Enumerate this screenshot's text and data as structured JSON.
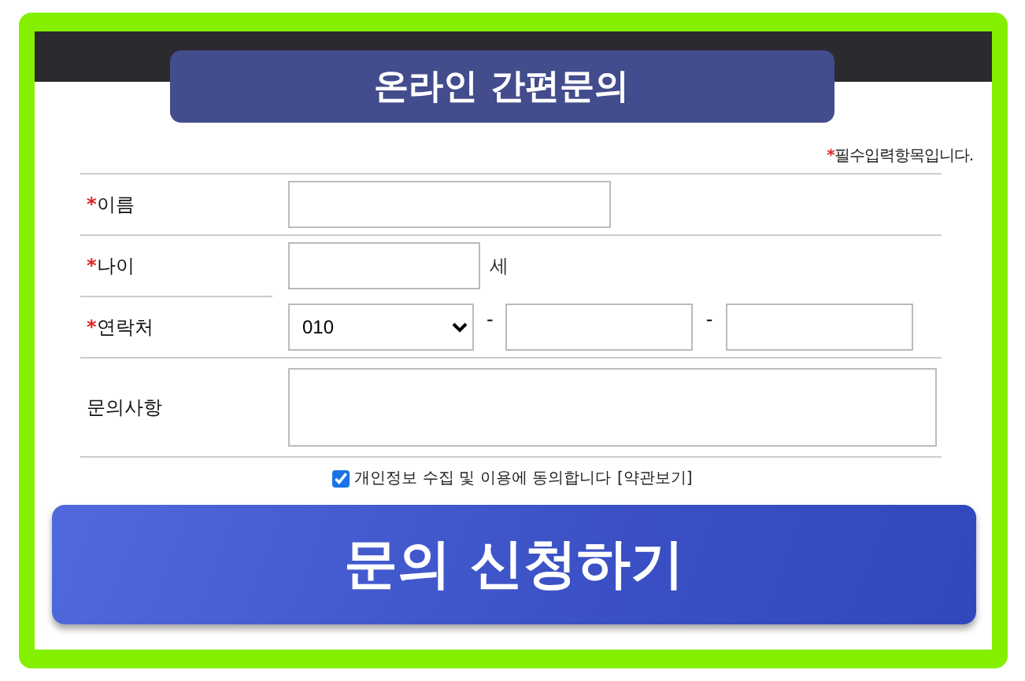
{
  "title": "온라인 간편문의",
  "required_note": {
    "mark": "*",
    "text": "필수입력항목입니다."
  },
  "rows": [
    {
      "kind": "text",
      "mark": "*",
      "label": "이름"
    },
    {
      "kind": "age",
      "mark": "*",
      "label": "나이",
      "unit": "세"
    },
    {
      "kind": "phone",
      "mark": "*",
      "label": "연락처",
      "value": "010",
      "separators": [
        "-",
        "-"
      ]
    },
    {
      "kind": "textarea",
      "label": "문의사항"
    }
  ],
  "consent": {
    "checked": true,
    "text": "개인정보 수집 및 이용에 동의합니다",
    "link": "[약관보기]"
  },
  "submit": "문의 신청하기"
}
